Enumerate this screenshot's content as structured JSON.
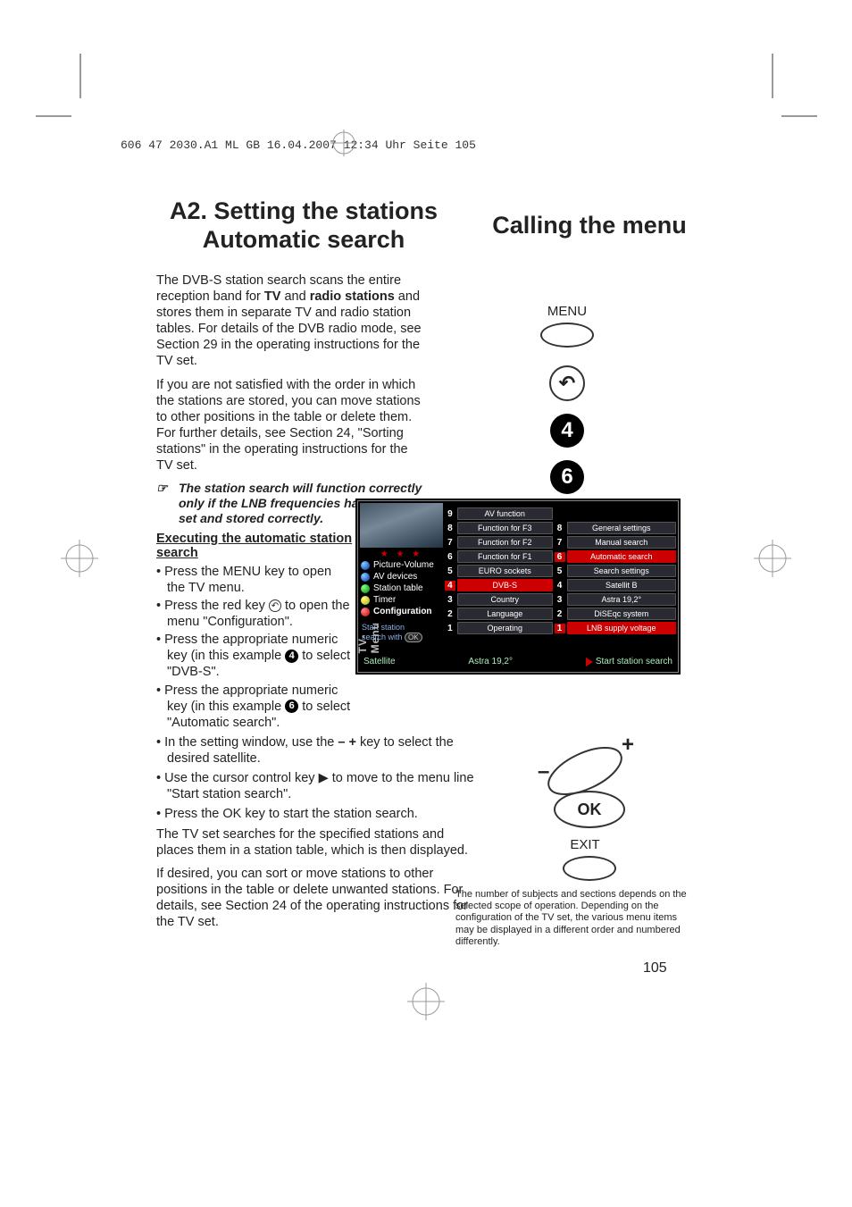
{
  "header_line": "606 47 2030.A1  ML GB   16.04.2007   12:34 Uhr   Seite 105",
  "title_left_line1": "A2. Setting the stations",
  "title_left_line2": "Automatic search",
  "title_right": "Calling the menu",
  "para1_a": "The DVB-S station search scans the entire reception band for ",
  "para1_b": "TV",
  "para1_c": " and ",
  "para1_d": "radio stations",
  "para1_e": " and stores them in separate TV and radio station tables. For details of the DVB radio mode, see Section 29 in the operating instructions for the TV set.",
  "para2": "If you are not satisfied with the order in which the stations are stored, you can move stations to other positions in the table or delete them. For further details, see Section 24, \"Sorting stations\" in the operating instructions for the TV set.",
  "notice_icon": "☞",
  "notice": "The station search will function correctly only if the LNB frequencies have been set and stored correctly.",
  "subhead": "Executing the automatic station search",
  "bullet1": "• Press the MENU key to open the TV menu.",
  "bullet2a": "• Press the red key ",
  "bullet2b": " to open the menu \"Configuration\".",
  "bullet3a": "• Press the appropriate numeric key (in this example ",
  "bullet3b": " to select \"DVB-S\".",
  "bullet3num": "4",
  "bullet4a": "• Press the appropriate numeric key (in this example ",
  "bullet4b": " to select \"Automatic search\".",
  "bullet4num": "6",
  "bullet5a": "• In the setting window, use the ",
  "bullet5minus": "–",
  "bullet5plus": " +",
  "bullet5b": " key to select the desired satellite.",
  "bullet6a": "• Use the cursor control key ",
  "bullet6arrow": "▶",
  "bullet6b": " to move to the menu line \"Start station search\".",
  "bullet7": "• Press the OK key to start the station search.",
  "para3": "The TV set searches for the specified stations and places them in a station table, which is then displayed.",
  "para4": "If desired, you can sort or move stations to other positions in the table or delete unwanted stations. For details, see Section 24 of the operating instructions for the TV set.",
  "remote": {
    "menu_label": "MENU",
    "back_icon": "↶",
    "num4": "4",
    "num6": "6",
    "ok_label": "OK",
    "exit_label": "EXIT",
    "plus": "+",
    "minus": "–"
  },
  "tv_menu": {
    "side_label": "TV-Menu",
    "stars": "★ ★ ★",
    "left_items": [
      "Picture-Volume",
      "AV devices",
      "Station table",
      "Timer",
      "Configuration"
    ],
    "hint_a": "Start station",
    "hint_b": "search with ",
    "hint_ok": "OK",
    "col1": [
      {
        "n": "9",
        "lbl": "AV function"
      },
      {
        "n": "8",
        "lbl": "Function for F3"
      },
      {
        "n": "7",
        "lbl": "Function for F2"
      },
      {
        "n": "6",
        "lbl": "Function for F1"
      },
      {
        "n": "5",
        "lbl": "EURO sockets"
      },
      {
        "n": "4",
        "lbl": "DVB-S"
      },
      {
        "n": "3",
        "lbl": "Country"
      },
      {
        "n": "2",
        "lbl": "Language"
      },
      {
        "n": "1",
        "lbl": "Operating"
      }
    ],
    "col2": [
      {
        "n": "8",
        "lbl": "General settings"
      },
      {
        "n": "7",
        "lbl": "Manual search"
      },
      {
        "n": "6",
        "lbl": "Automatic search"
      },
      {
        "n": "5",
        "lbl": "Search settings"
      },
      {
        "n": "4",
        "lbl": "Satellit B"
      },
      {
        "n": "3",
        "lbl": "Astra 19,2°"
      },
      {
        "n": "2",
        "lbl": "DiSEqc system"
      },
      {
        "n": "1",
        "lbl": "LNB supply voltage"
      }
    ],
    "bottom": {
      "satellite": "Satellite",
      "astra": "Astra 19,2°",
      "start": "Start station search"
    }
  },
  "footnote": "The number of subjects and sections depends on the selected scope of operation. Depending on the configuration of the TV set, the various menu items may be displayed in a different order and numbered differently.",
  "page_num": "105"
}
